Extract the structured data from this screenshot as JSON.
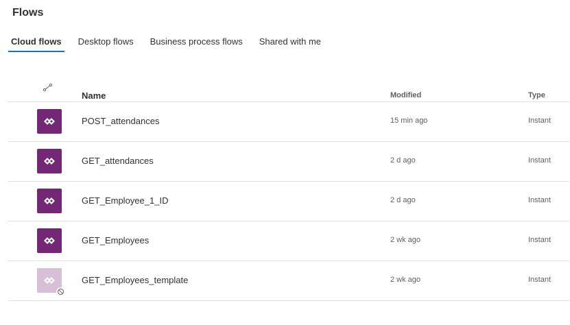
{
  "page": {
    "title": "Flows"
  },
  "tabs": [
    {
      "label": "Cloud flows",
      "active": true
    },
    {
      "label": "Desktop flows",
      "active": false
    },
    {
      "label": "Business process flows",
      "active": false
    },
    {
      "label": "Shared with me",
      "active": false
    }
  ],
  "table": {
    "header_icon": "flow-type-icon",
    "columns": {
      "name": "Name",
      "modified": "Modified",
      "type": "Type"
    },
    "rows": [
      {
        "name": "POST_attendances",
        "modified": "15 min ago",
        "type": "Instant",
        "enabled": true
      },
      {
        "name": "GET_attendances",
        "modified": "2 d ago",
        "type": "Instant",
        "enabled": true
      },
      {
        "name": "GET_Employee_1_ID",
        "modified": "2 d ago",
        "type": "Instant",
        "enabled": true
      },
      {
        "name": "GET_Employees",
        "modified": "2 wk ago",
        "type": "Instant",
        "enabled": true
      },
      {
        "name": "GET_Employees_template",
        "modified": "2 wk ago",
        "type": "Instant",
        "enabled": false
      }
    ]
  },
  "colors": {
    "accent": "#0078d4",
    "flow_tile": "#742774",
    "flow_tile_disabled": "#d8bfd8",
    "divider": "#e1dfdd"
  }
}
